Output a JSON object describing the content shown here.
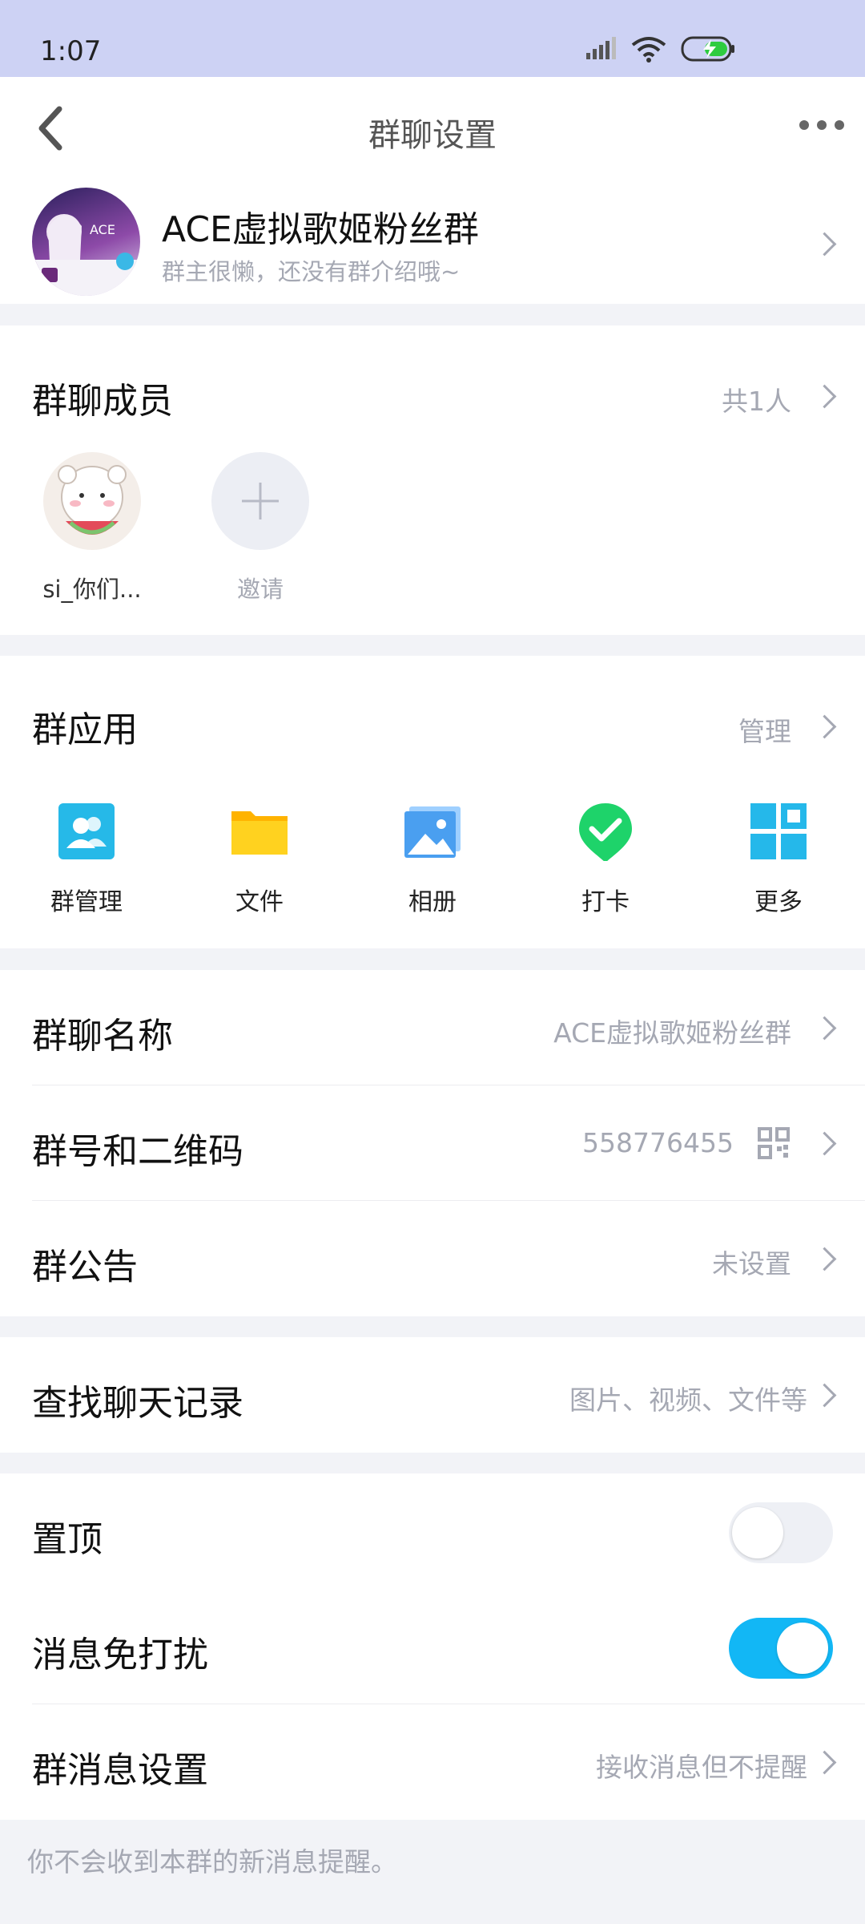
{
  "status_bar": {
    "time": "1:07"
  },
  "nav": {
    "title": "群聊设置"
  },
  "group": {
    "name": "ACE虚拟歌姬粉丝群",
    "intro": "群主很懒，还没有群介绍哦~"
  },
  "members": {
    "title": "群聊成员",
    "count": "共1人",
    "list": [
      {
        "name": "si_你们..."
      }
    ],
    "invite_label": "邀请"
  },
  "apps": {
    "title": "群应用",
    "manage": "管理",
    "items": [
      {
        "label": "群管理",
        "icon": "group-manage-icon",
        "color": "#26b9e8"
      },
      {
        "label": "文件",
        "icon": "folder-icon",
        "color": "#ffc400"
      },
      {
        "label": "相册",
        "icon": "album-icon",
        "color": "#4a9ff0"
      },
      {
        "label": "打卡",
        "icon": "checkin-icon",
        "color": "#1ed36a"
      },
      {
        "label": "更多",
        "icon": "grid-icon",
        "color": "#25b8ea"
      }
    ]
  },
  "settings": {
    "group_name": {
      "label": "群聊名称",
      "value": "ACE虚拟歌姬粉丝群"
    },
    "group_number": {
      "label": "群号和二维码",
      "value": "558776455"
    },
    "notice": {
      "label": "群公告",
      "value": "未设置"
    },
    "search_history": {
      "label": "查找聊天记录",
      "value": "图片、视频、文件等"
    },
    "pin": {
      "label": "置顶",
      "on": false
    },
    "mute": {
      "label": "消息免打扰",
      "on": true
    },
    "message_settings": {
      "label": "群消息设置",
      "value": "接收消息但不提醒"
    }
  },
  "footer_note": "你不会收到本群的新消息提醒。",
  "colors": {
    "accent": "#12b7f5",
    "status_bar": "#cdd2f4",
    "background": "#f2f3f7"
  }
}
